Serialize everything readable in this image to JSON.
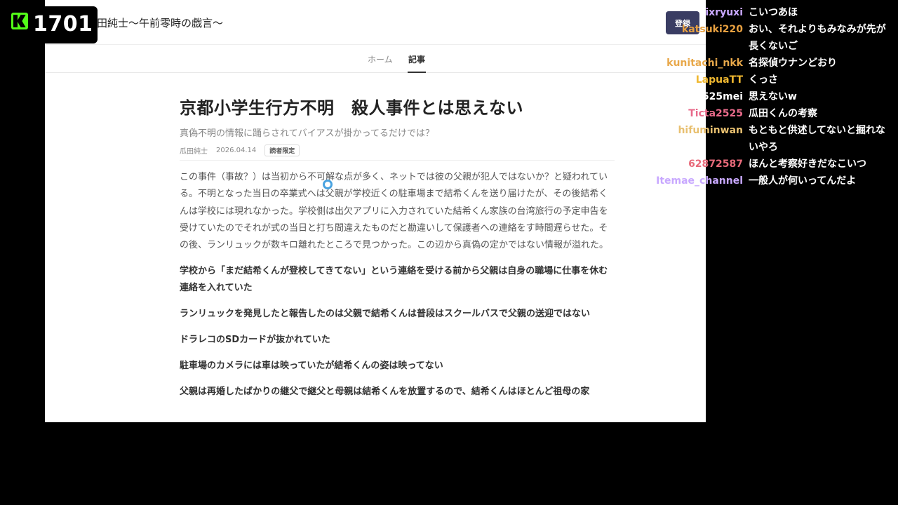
{
  "stream": {
    "viewer_count": "1701"
  },
  "site": {
    "title": "田純士～午前零時の戯言～",
    "login_label": "登録",
    "nav": {
      "home": "ホーム",
      "articles": "記事"
    }
  },
  "article": {
    "title": "京都小学生行方不明　殺人事件とは思えない",
    "subtitle": "真偽不明の情報に踊らされてバイアスが掛かってるだけでは？",
    "author": "瓜田純士",
    "date": "2026.04.14",
    "badge": "読者限定",
    "lead": "この事件（事故？）は当初から不可解な点が多く、ネットでは彼の父親が犯人ではないか？と疑われている。不明となった当日の卒業式へは父親が学校近くの駐車場まで結希くんを送り届けたが、その後結希くんは学校には現れなかった。学校側は出欠アプリに入力されていた結希くん家族の台湾旅行の予定申告を受けていたのでそれが式の当日と打ち間違えたものだと勘違いして保護者への連絡をす時間遅らせた。その後、ランリュックが数キロ離れたところで見つかった。この辺から真偽の定かではない情報が溢れた。",
    "points": [
      "学校から「まだ結希くんが登校してきてない」という連絡を受ける前から父親は自身の職場に仕事を休む連絡を入れていた",
      "ランリュックを発見したと報告したのは父親で結希くんは普段はスクールバスで父親の送迎ではない",
      "ドラレコのSDカードが抜かれていた",
      "駐車場のカメラには車は映っていたが結希くんの姿は映ってない",
      "父親は再婚したばかりの継父で継父と母親は結希くんを放置するので、結希くんはほとんど祖母の家"
    ]
  },
  "chat": [
    {
      "user": "ixryuxi",
      "text": "こいつあほ",
      "color": "#c9a8ff"
    },
    {
      "user": "katsuki220",
      "text": "おい、それよりもみなみが先が長くないご",
      "color": "#e8a040"
    },
    {
      "user": "kunitachi_nkk",
      "text": "名探偵ウナンどおり",
      "color": "#e8a84a"
    },
    {
      "user": "LapuaTT",
      "text": "くっさ",
      "color": "#f0b830"
    },
    {
      "user": "2525mei",
      "text": "思えないw",
      "color": "#ffffff"
    },
    {
      "user": "Ticta2525",
      "text": "瓜田くんの考察",
      "color": "#e86a8a"
    },
    {
      "user": "hifuminwan",
      "text": "もともと供述してないと掘れないやろ",
      "color": "#e8c070"
    },
    {
      "user": "62872587",
      "text": "ほんと考察好きだなこいつ",
      "color": "#e86a7a"
    },
    {
      "user": "Itemae_channel",
      "text": "一般人が何いってんだよ",
      "color": "#c8a8ff"
    }
  ],
  "colors": {
    "login_bg": "#3a3d63",
    "kick_green": "#53fc18",
    "cursor": "#4aa3e0"
  }
}
